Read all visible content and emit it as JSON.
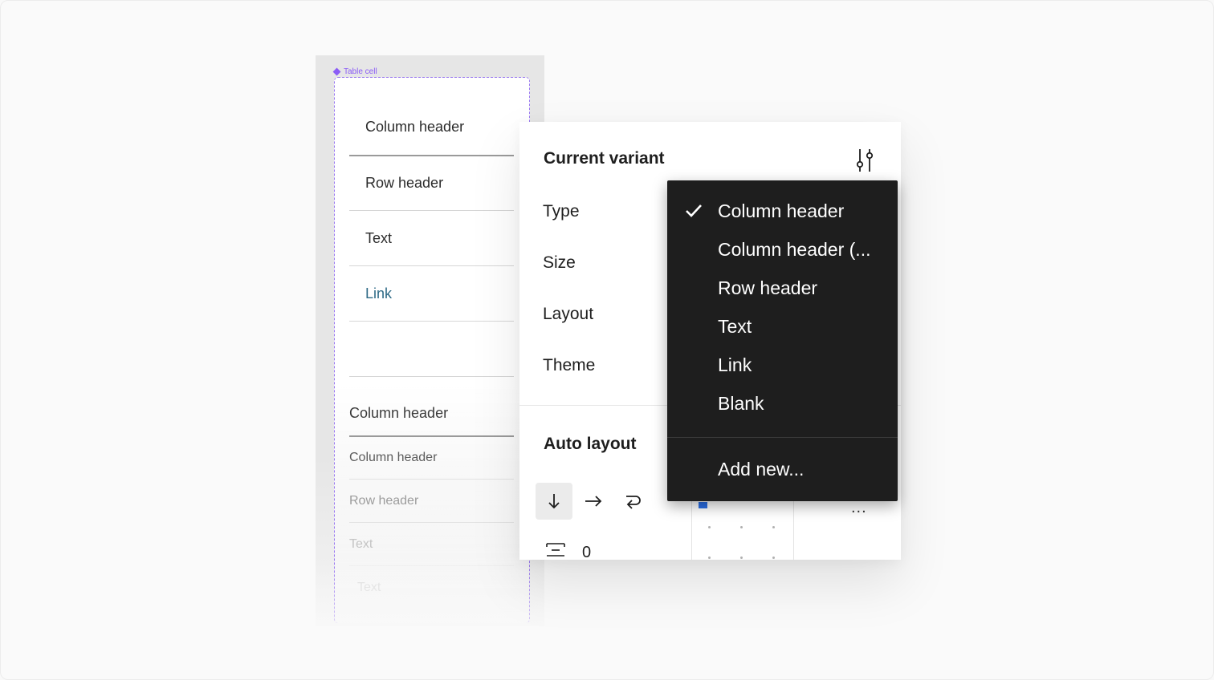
{
  "canvas": {
    "component_label": "Table cell",
    "cells": [
      {
        "text": "Column header"
      },
      {
        "text": "Row header"
      },
      {
        "text": "Text"
      },
      {
        "text": "Link"
      },
      {
        "text": ""
      },
      {
        "text": "Column header"
      },
      {
        "text": "Column header"
      },
      {
        "text": "Row header"
      },
      {
        "text": "Text"
      },
      {
        "text": "Text"
      }
    ]
  },
  "panel": {
    "title": "Current variant",
    "properties": [
      {
        "label": "Type"
      },
      {
        "label": "Size"
      },
      {
        "label": "Layout"
      },
      {
        "label": "Theme"
      }
    ],
    "auto_layout": {
      "title": "Auto layout",
      "spacing_value": "0",
      "more": "..."
    }
  },
  "dropdown": {
    "items": [
      {
        "label": "Column header",
        "selected": true
      },
      {
        "label": "Column header (...",
        "selected": false
      },
      {
        "label": "Row header",
        "selected": false
      },
      {
        "label": "Text",
        "selected": false
      },
      {
        "label": "Link",
        "selected": false
      },
      {
        "label": "Blank",
        "selected": false
      }
    ],
    "add_new": "Add new..."
  },
  "icons": {
    "variant_settings": "sliders-icon",
    "check": "check-icon",
    "direction_vertical": "arrow-down-icon",
    "direction_horizontal": "arrow-right-icon",
    "direction_wrap": "wrap-icon",
    "spacing": "vertical-spacing-icon",
    "component": "component-diamond-icon"
  },
  "colors": {
    "accent": "#8b5cf6",
    "link": "#2e6a86",
    "dropdown_bg": "#1e1e1e",
    "alignment_marker": "#2b6fe6"
  }
}
